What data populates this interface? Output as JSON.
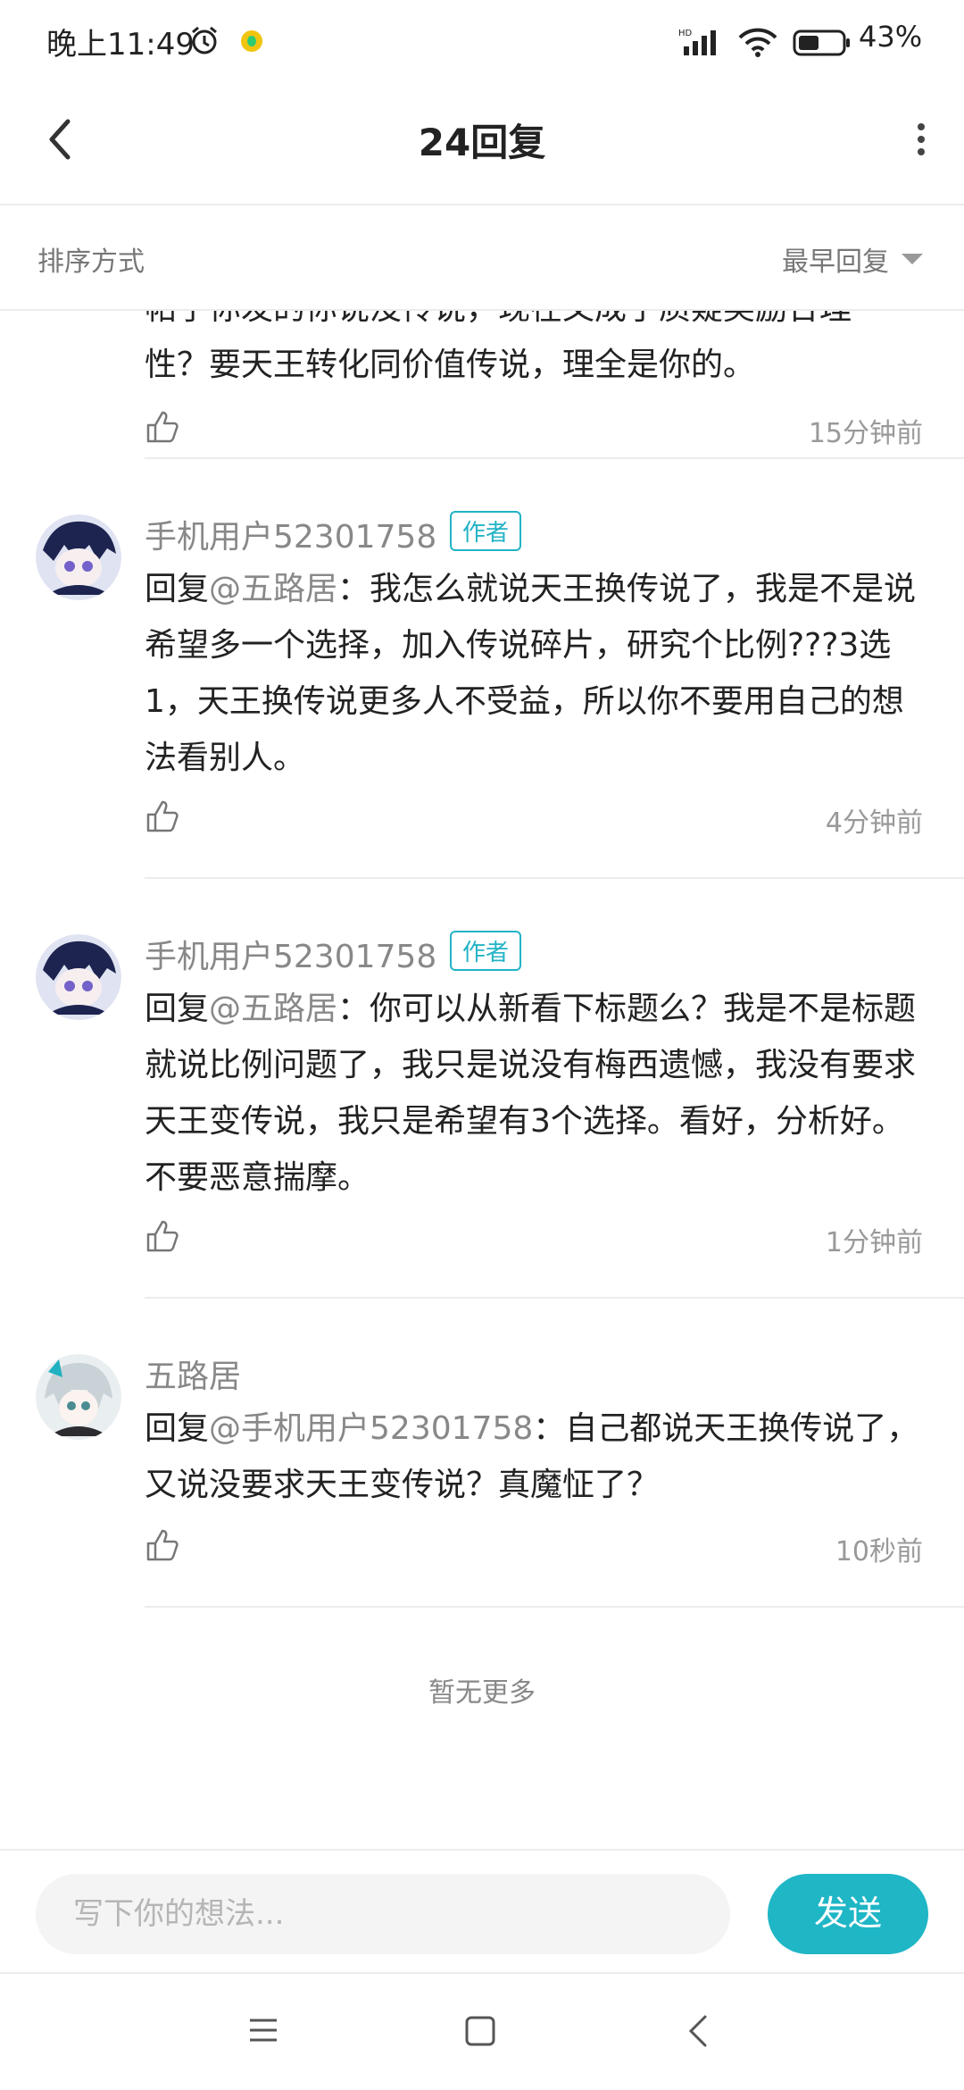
{
  "status_bar": {
    "time": "晚上11:49",
    "battery": "43%"
  },
  "nav": {
    "title": "24回复"
  },
  "sort": {
    "label": "排序方式",
    "value": "最早回复"
  },
  "comments": [
    {
      "type": "partial",
      "body_lines": [
        "帖子你发的你说没传说，现在又成了质疑奖励合理",
        "性？要天王转化同价值传说，理全是你的。"
      ],
      "time": "15分钟前"
    },
    {
      "username": "手机用户52301758",
      "badge": "作者",
      "reply_prefix": "回复",
      "reply_to": "@五路居",
      "body": "：我怎么就说天王换传说了，我是不是说希望多一个选择，加入传说碎片，研究个比例???3选1，天王换传说更多人不受益，所以你不要用自己的想法看别人。",
      "time": "4分钟前"
    },
    {
      "username": "手机用户52301758",
      "badge": "作者",
      "reply_prefix": "回复",
      "reply_to": "@五路居",
      "body": "：你可以从新看下标题么？我是不是标题就说比例问题了，我只是说没有梅西遗憾，我没有要求天王变传说，我只是希望有3个选择。看好，分析好。不要恶意揣摩。",
      "time": "1分钟前"
    },
    {
      "username": "五路居",
      "reply_prefix": "回复",
      "reply_to": "@手机用户52301758",
      "body": "：自己都说天王换传说了，又说没要求天王变传说？真魔怔了？",
      "time": "10秒前"
    }
  ],
  "no_more": "暂无更多",
  "input": {
    "placeholder": "写下你的想法...",
    "send_label": "发送"
  }
}
